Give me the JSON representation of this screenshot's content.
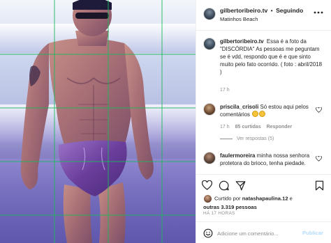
{
  "post": {
    "username": "gilbertoribeiro.tv",
    "separator": "•",
    "follow_state": "Seguindo",
    "location": "Matinhos Beach"
  },
  "caption": {
    "username": "gilbertoribeiro.tv",
    "text": "Essa é a foto da \"DISCÓRDIA\" As pessoas me peguntam se é vdd, respondo que é e que sinto muito pelo fato ocorrido. ( foto : abril/2018 )",
    "time": "17 h"
  },
  "comments": [
    {
      "username": "priscila_crisoli",
      "text": "Só estou aqui pelos comentários",
      "emoji_count": 2,
      "time": "17 h",
      "likes": "85 curtidas",
      "reply": "Responder"
    },
    {
      "username": "faulermoreira",
      "text": "minha nossa senhora protetora do brioco, tenha piedade."
    }
  ],
  "replies": {
    "label": "Ver respostas (5)"
  },
  "likes": {
    "prefix": "Curtido por",
    "user": "natashapaulina.12",
    "connector": "e",
    "others": "outras 3.319 pessoas"
  },
  "timestamp": "HÁ 17 HORAS",
  "comment_box": {
    "placeholder": "Adicione um comentário...",
    "publish_label": "Publicar"
  },
  "icons": {
    "more": "more-horizontal-icon",
    "like": "heart-icon",
    "comment": "comment-bubble-icon",
    "share": "paper-plane-icon",
    "save": "bookmark-icon",
    "emoji": "smile-icon"
  },
  "colors": {
    "text": "#262626",
    "muted": "#8e8e8e",
    "border": "#efefef",
    "publish_disabled": "#b3dbff",
    "grid_line": "#1db85c"
  }
}
